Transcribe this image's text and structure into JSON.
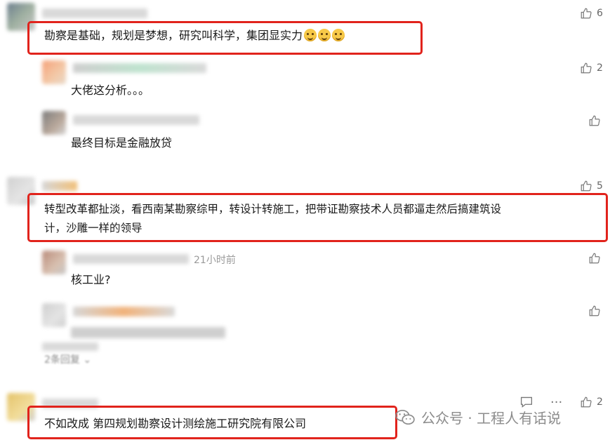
{
  "colors": {
    "highlight": "#e1231c",
    "meta_text": "#9a9a9a",
    "body_text": "#1a1a1a"
  },
  "comments": [
    {
      "id": "c1",
      "text": "勘察是基础，规划是梦想，研究叫科学，集团显实力",
      "emoji_count": 3,
      "emoji_icon": "sweat-smile-emoji",
      "likes": "6",
      "replies": [
        {
          "text": "大佬这分析。。。",
          "likes": "2"
        },
        {
          "text": "最终目标是金融放贷",
          "likes": ""
        }
      ]
    },
    {
      "id": "c2",
      "text_line1": "转型改革都扯淡，看西南某勘察综甲，转设计转施工，把带证勘察技术人员都逼走然后搞建筑设",
      "text_line2": "计，沙雕一样的领导",
      "likes": "5",
      "replies": [
        {
          "text": "核工业?",
          "time": "21小时前",
          "likes": ""
        },
        {
          "text": "",
          "likes": ""
        }
      ],
      "more_replies": "2条回复"
    },
    {
      "id": "c3",
      "text": "不如改成 第四规划勘察设计测绘施工研究院有限公司",
      "likes": "2"
    }
  ],
  "watermark": {
    "text": "公众号 · 工程人有话说",
    "icon": "wechat-icon"
  }
}
